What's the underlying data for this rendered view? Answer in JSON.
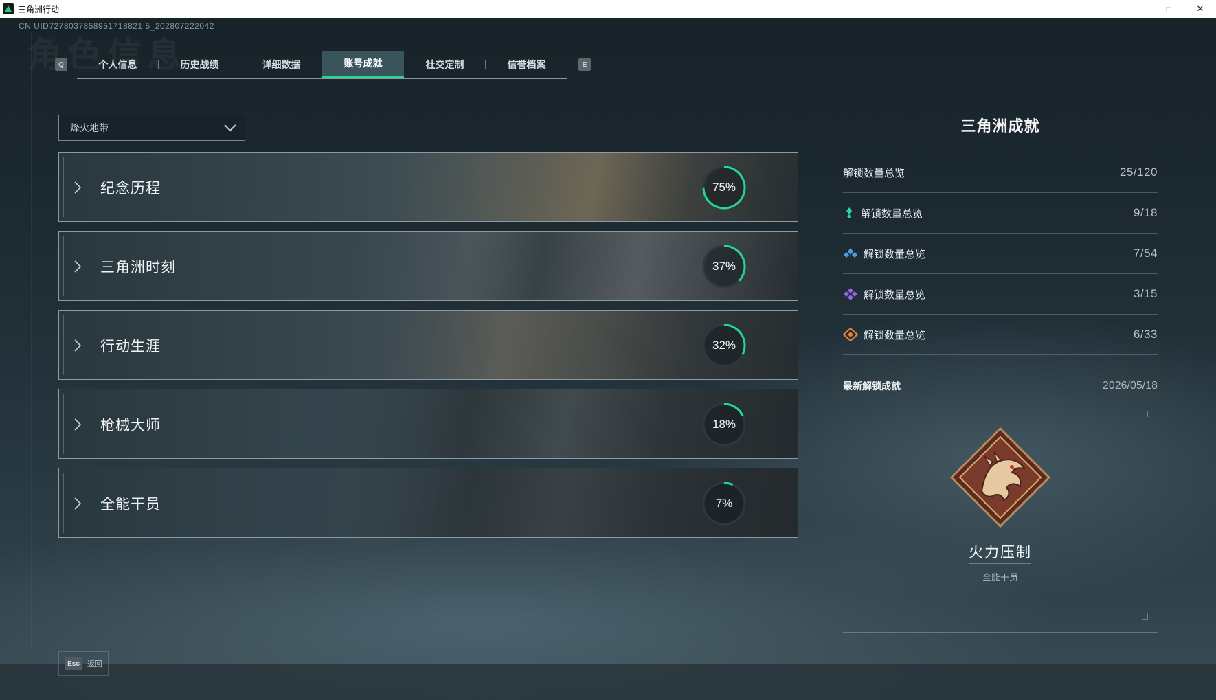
{
  "window": {
    "title": "三角洲行动",
    "controls": {
      "minimize": "–",
      "maximize": "□",
      "close": "✕"
    }
  },
  "header": {
    "uid": "CN UID7278037858951718821 5_202807222042",
    "ghost_title": "角色信息"
  },
  "tabs": {
    "left_key": "Q",
    "right_key": "E",
    "items": [
      {
        "label": "个人信息"
      },
      {
        "label": "历史战绩"
      },
      {
        "label": "详细数据"
      },
      {
        "label": "账号成就",
        "active": true
      },
      {
        "label": "社交定制"
      },
      {
        "label": "信誉档案"
      }
    ]
  },
  "dropdown": {
    "value": "烽火地带"
  },
  "categories": [
    {
      "name": "纪念历程",
      "percent_text": "75%",
      "progress": 0.75
    },
    {
      "name": "三角洲时刻",
      "percent_text": "37%",
      "progress": 0.37
    },
    {
      "name": "行动生涯",
      "percent_text": "32%",
      "progress": 0.32
    },
    {
      "name": "枪械大师",
      "percent_text": "18%",
      "progress": 0.18
    },
    {
      "name": "全能干员",
      "percent_text": "7%",
      "progress": 0.07
    }
  ],
  "panel": {
    "title": "三角洲成就",
    "total": {
      "label": "解锁数量总览",
      "value": "25/120"
    },
    "tiers": [
      {
        "label": "解锁数量总览",
        "value": "9/18",
        "icon": "green-diamond-icon",
        "color": "#2fd39a"
      },
      {
        "label": "解锁数量总览",
        "value": "7/54",
        "icon": "blue-diamond-icon",
        "color": "#4d9be8"
      },
      {
        "label": "解锁数量总览",
        "value": "3/15",
        "icon": "purple-diamond-icon",
        "color": "#9a62e8"
      },
      {
        "label": "解锁数量总览",
        "value": "6/33",
        "icon": "orange-diamond-icon",
        "color": "#e8843a"
      }
    ],
    "latest": {
      "label": "最新解锁成就",
      "date": "2026/05/18",
      "achievement_name": "火力压制",
      "achievement_category": "全能干员",
      "medal_icon": "dragon-medal-icon"
    }
  },
  "footer": {
    "key": "Esc",
    "label": "返回"
  },
  "colors": {
    "accent": "#25d891",
    "ring_track": "#2a3a40"
  }
}
